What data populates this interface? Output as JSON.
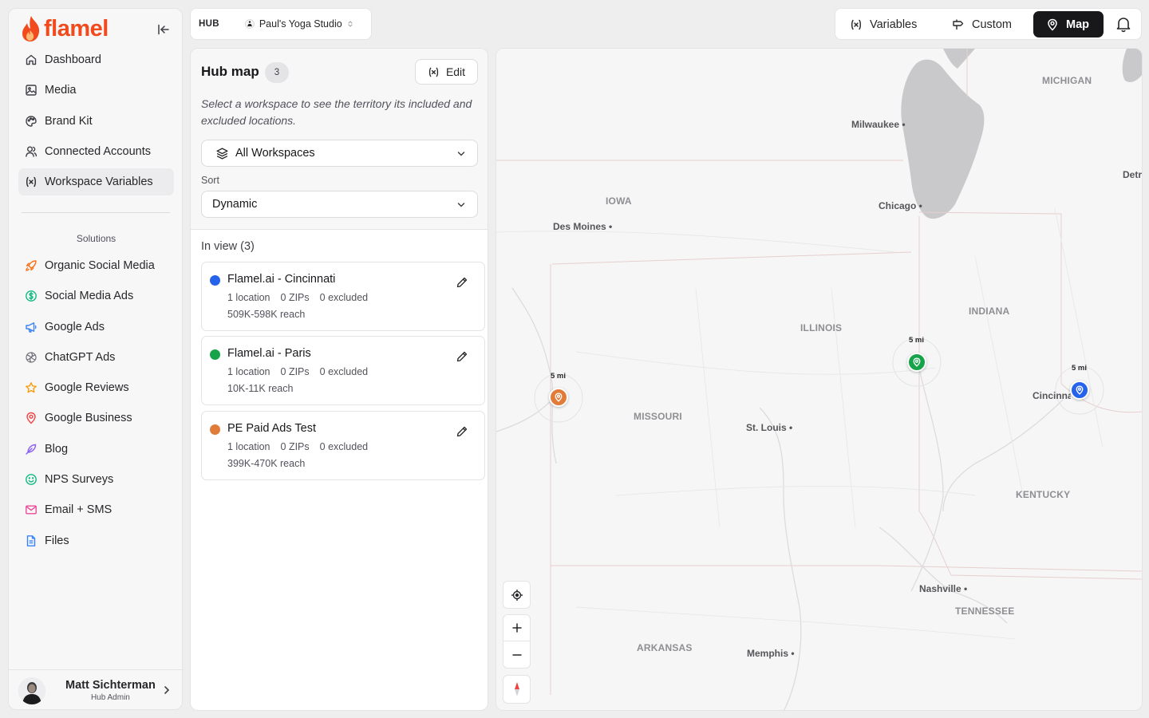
{
  "brand": {
    "name": "flamel",
    "accent": "#f04a1d"
  },
  "sidebar": {
    "items": [
      {
        "label": "Dashboard",
        "icon": "home-icon"
      },
      {
        "label": "Media",
        "icon": "image-icon"
      },
      {
        "label": "Brand Kit",
        "icon": "palette-icon"
      },
      {
        "label": "Connected Accounts",
        "icon": "users-icon"
      },
      {
        "label": "Workspace Variables",
        "icon": "variable-icon",
        "active": true
      }
    ],
    "solutions_label": "Solutions",
    "solutions": [
      {
        "label": "Organic Social Media",
        "icon": "rocket-icon",
        "color": "#f97316"
      },
      {
        "label": "Social Media Ads",
        "icon": "dollar-icon",
        "color": "#10b981"
      },
      {
        "label": "Google Ads",
        "icon": "megaphone-icon",
        "color": "#3b82f6"
      },
      {
        "label": "ChatGPT Ads",
        "icon": "openai-icon",
        "color": "#71717a"
      },
      {
        "label": "Google Reviews",
        "icon": "star-icon",
        "color": "#f59e0b"
      },
      {
        "label": "Google Business",
        "icon": "location-pin-icon",
        "color": "#ef4444"
      },
      {
        "label": "Blog",
        "icon": "feather-icon",
        "color": "#8b5cf6"
      },
      {
        "label": "NPS Surveys",
        "icon": "smile-icon",
        "color": "#10b981"
      },
      {
        "label": "Email + SMS",
        "icon": "mail-icon",
        "color": "#ec4899"
      },
      {
        "label": "Files",
        "icon": "file-icon",
        "color": "#3b82f6"
      }
    ],
    "user": {
      "name": "Matt Sichterman",
      "role": "Hub Admin"
    }
  },
  "hub": {
    "label": "HUB",
    "studio": "Paul's Yoga Studio"
  },
  "toolbar": {
    "variables": "Variables",
    "custom": "Custom",
    "map": "Map"
  },
  "panel": {
    "title": "Hub map",
    "count": "3",
    "edit": "Edit",
    "description": "Select a workspace to see the territory its included and excluded locations.",
    "workspace_select": "All Workspaces",
    "sort_label": "Sort",
    "sort_value": "Dynamic",
    "in_view": "In view (3)",
    "cards": [
      {
        "title": "Flamel.ai - Cincinnati",
        "color": "#2563eb",
        "locations": "1 location",
        "zips": "0 ZIPs",
        "excluded": "0 excluded",
        "reach": "509K-598K reach"
      },
      {
        "title": "Flamel.ai - Paris",
        "color": "#16a34a",
        "locations": "1 location",
        "zips": "0 ZIPs",
        "excluded": "0 excluded",
        "reach": "10K-11K reach"
      },
      {
        "title": "PE Paid Ads Test",
        "color": "#e07b39",
        "locations": "1 location",
        "zips": "0 ZIPs",
        "excluded": "0 excluded",
        "reach": "399K-470K reach"
      }
    ]
  },
  "map": {
    "states": [
      "MICHIGAN",
      "IOWA",
      "ILLINOIS",
      "INDIANA",
      "MISSOURI",
      "KENTUCKY",
      "TENNESSEE",
      "ARKANSAS"
    ],
    "cities": [
      "Milwaukee",
      "Chicago",
      "Des Moines",
      "St. Louis",
      "Cincinnati",
      "Nashville",
      "Memphis",
      "Detroit"
    ],
    "radius_label": "5 mi",
    "pins": [
      {
        "name": "Flamel.ai - Paris",
        "color": "#16a34a"
      },
      {
        "name": "Flamel.ai - Cincinnati",
        "color": "#2563eb"
      },
      {
        "name": "PE Paid Ads Test",
        "color": "#e07b39"
      }
    ]
  }
}
